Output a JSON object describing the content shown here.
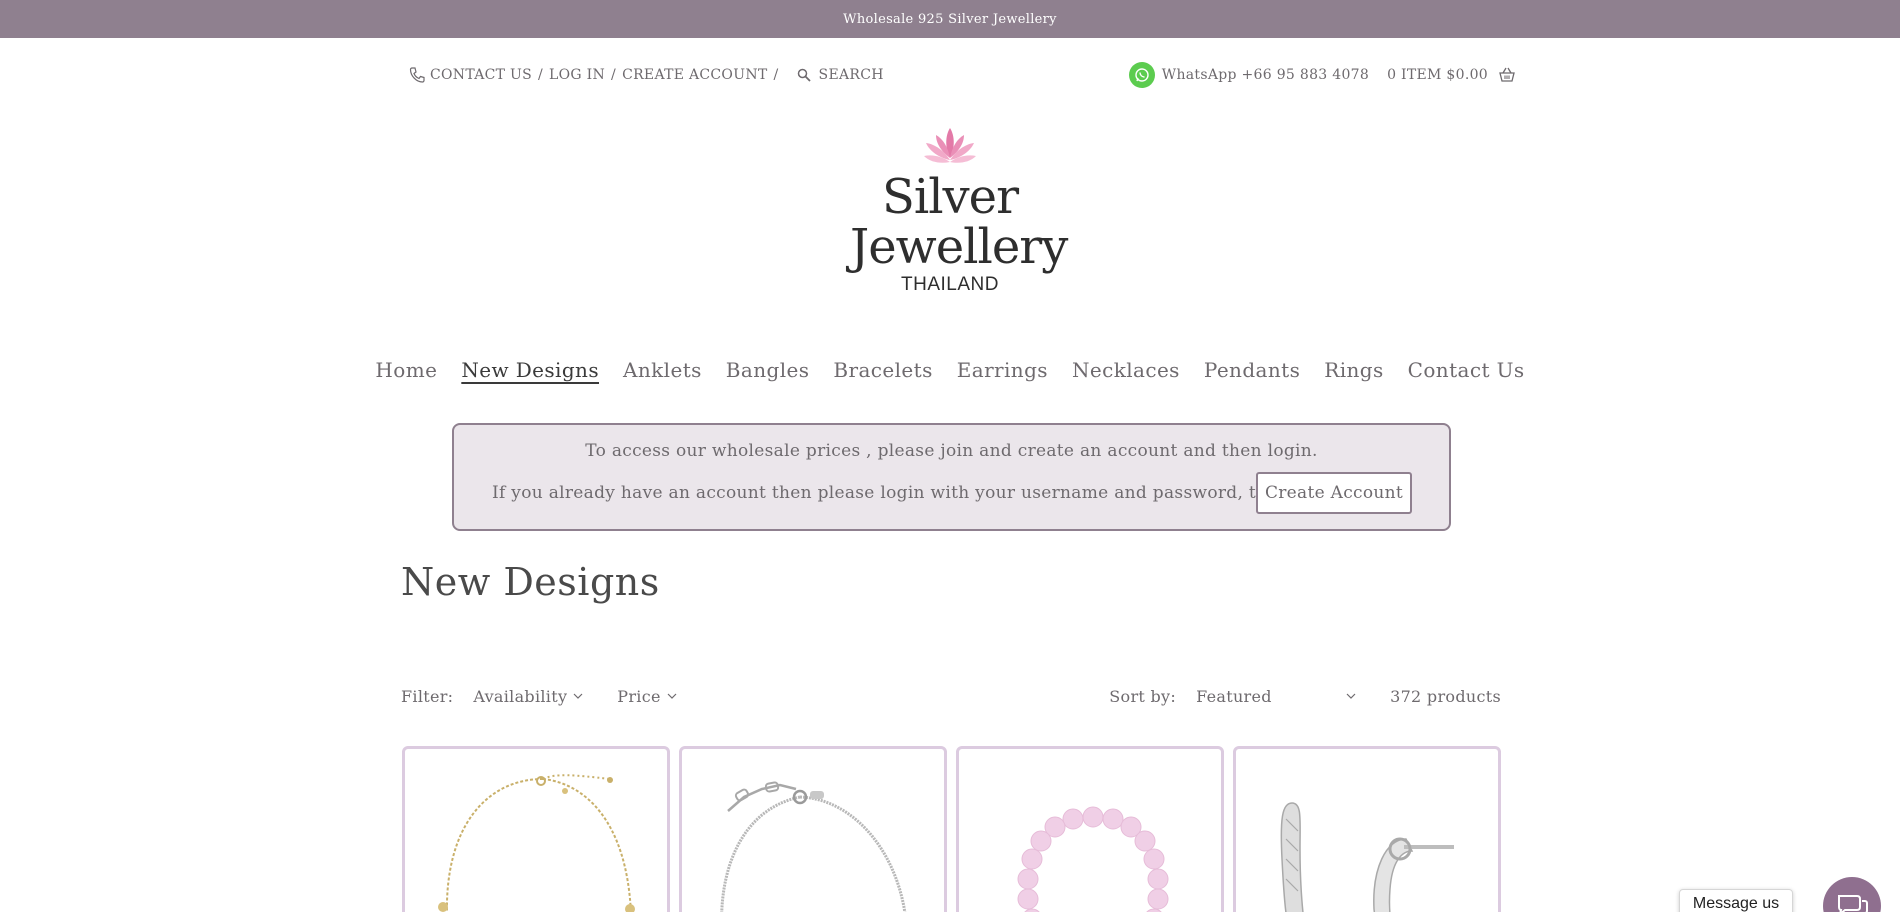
{
  "announcement": "Wholesale 925 Silver Jewellery",
  "header": {
    "contact_label": "CONTACT US",
    "separator": "/",
    "login_label": "LOG IN",
    "create_label": "CREATE ACCOUNT",
    "search_placeholder": "SEARCH",
    "whatsapp_label": "WhatsApp +66 95 883 4078",
    "cart_label": "0 ITEM $0.00",
    "icons": [
      "phone-icon",
      "search-icon",
      "whatsapp-icon",
      "basket-icon"
    ]
  },
  "logo": {
    "line1": "Silver",
    "line2": "Jewellery",
    "line3": "THAILAND",
    "color": "#2e2e2e",
    "lotus_color": "#e37aa8"
  },
  "nav": {
    "items": [
      {
        "label": "Home",
        "active": false
      },
      {
        "label": "New Designs",
        "active": true
      },
      {
        "label": "Anklets",
        "active": false
      },
      {
        "label": "Bangles",
        "active": false
      },
      {
        "label": "Bracelets",
        "active": false
      },
      {
        "label": "Earrings",
        "active": false
      },
      {
        "label": "Necklaces",
        "active": false
      },
      {
        "label": "Pendants",
        "active": false
      },
      {
        "label": "Rings",
        "active": false
      },
      {
        "label": "Contact Us",
        "active": false
      }
    ]
  },
  "notice": {
    "line1": "To access our wholesale prices , please join and create an account and then login.",
    "line2": "If you already have an account then please login with your username and password, thanks.",
    "button_label": "Create Account"
  },
  "collection": {
    "title": "New Designs",
    "filter_label": "Filter:",
    "filters": [
      "Availability",
      "Price"
    ],
    "sort_label": "Sort by:",
    "sort_value": "Featured",
    "product_count": "372 products"
  },
  "products": [
    {
      "icon": "gold-chain-anklet-image"
    },
    {
      "icon": "silver-chain-bracelet-image"
    },
    {
      "icon": "pink-bead-bracelet-image"
    },
    {
      "icon": "silver-hoop-earrings-image"
    }
  ],
  "chat": {
    "bubble_label": "Message us",
    "icon": "chat-icon"
  },
  "colors": {
    "accent": "#8f808f",
    "notice_bg": "#ebe6eb",
    "card_border": "#dccbe0",
    "whatsapp": "#5ccc4f",
    "text": "#6e6a6e"
  }
}
